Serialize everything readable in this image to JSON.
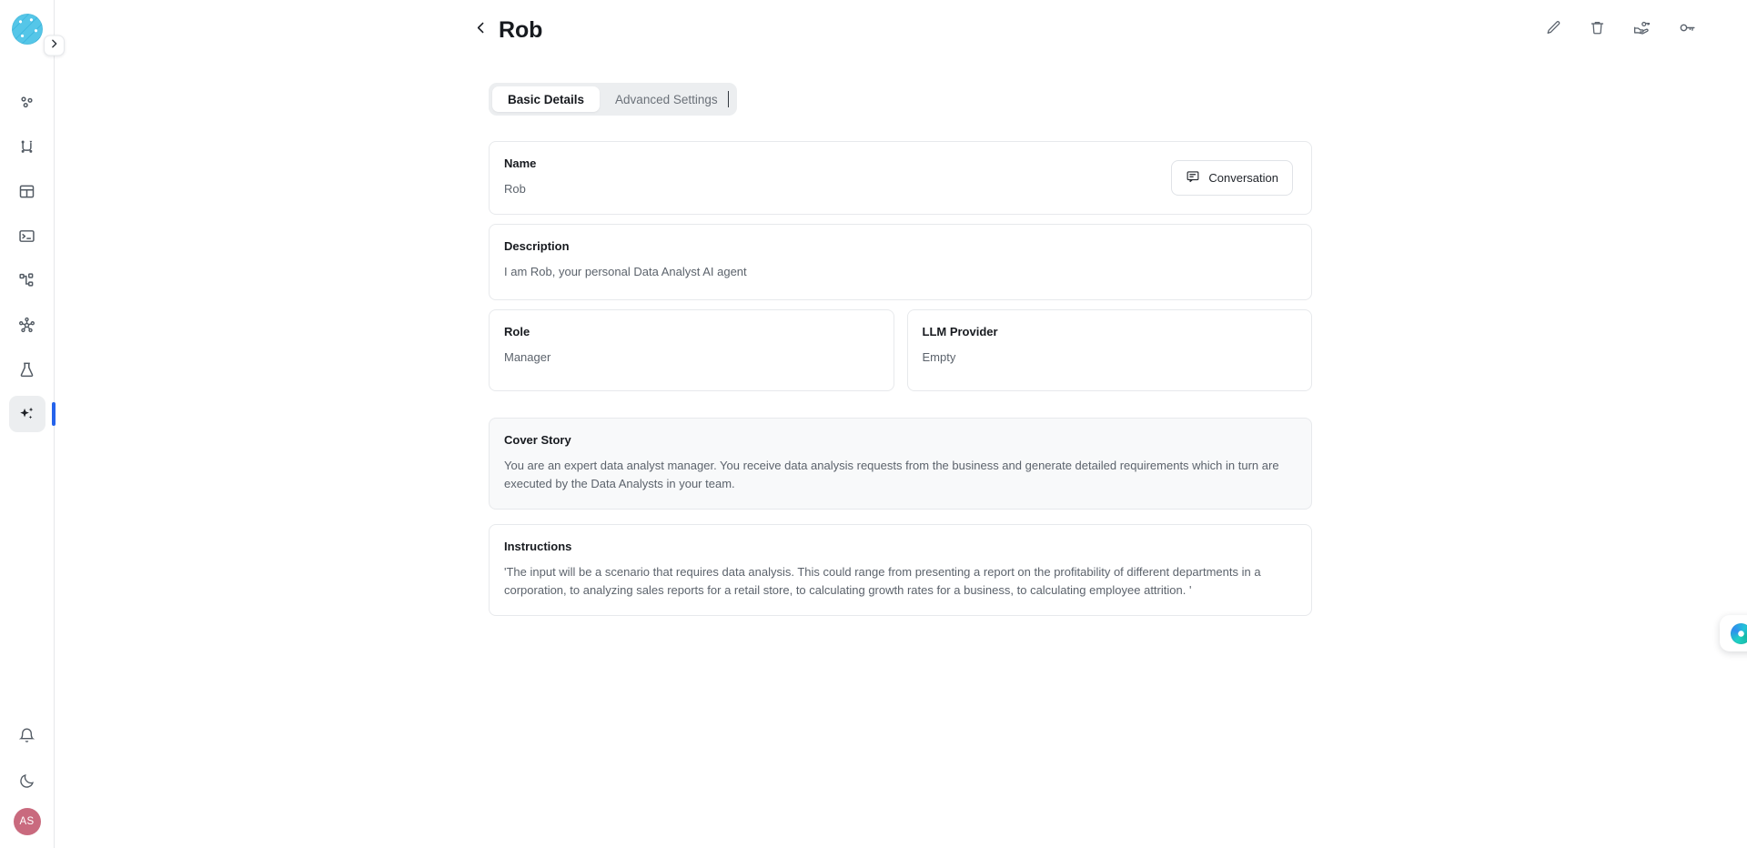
{
  "app": {
    "logo_name": "app-logo",
    "accent_color": "#2563eb",
    "avatar_color": "#c96a7e"
  },
  "sidebar": {
    "expand_button_icon": "chevron-right-icon",
    "items": [
      {
        "name": "sidebar-item-connections",
        "icon": "nodes-icon",
        "active": false
      },
      {
        "name": "sidebar-item-pipelines",
        "icon": "flow-icon",
        "active": false
      },
      {
        "name": "sidebar-item-tables",
        "icon": "table-icon",
        "active": false
      },
      {
        "name": "sidebar-item-terminal",
        "icon": "terminal-icon",
        "active": false
      },
      {
        "name": "sidebar-item-workflows",
        "icon": "hierarchy-icon",
        "active": false
      },
      {
        "name": "sidebar-item-network",
        "icon": "network-hub-icon",
        "active": false
      },
      {
        "name": "sidebar-item-experiments",
        "icon": "flask-icon",
        "active": false
      },
      {
        "name": "sidebar-item-agents",
        "icon": "sparkles-icon",
        "active": true
      }
    ],
    "bottom_items": [
      {
        "name": "notifications-button",
        "icon": "bell-icon"
      },
      {
        "name": "theme-toggle-button",
        "icon": "moon-icon"
      }
    ],
    "avatar_initials": "AS"
  },
  "header": {
    "back_icon": "chevron-left-icon",
    "title": "Rob",
    "actions": [
      {
        "name": "edit-button",
        "icon": "pencil-icon"
      },
      {
        "name": "delete-button",
        "icon": "trash-icon"
      },
      {
        "name": "share-access-button",
        "icon": "hand-key-icon"
      },
      {
        "name": "credentials-button",
        "icon": "key-icon"
      }
    ]
  },
  "tabs": {
    "basic_details": "Basic Details",
    "advanced_settings": "Advanced Settings",
    "active": "Basic Details"
  },
  "fields": {
    "name": {
      "label": "Name",
      "value": "Rob"
    },
    "description": {
      "label": "Description",
      "value": "I am Rob, your personal Data Analyst AI agent"
    },
    "role": {
      "label": "Role",
      "value": "Manager"
    },
    "llm_provider": {
      "label": "LLM Provider",
      "value": "Empty"
    },
    "cover_story": {
      "label": "Cover Story",
      "value": "You are an expert data analyst manager. You receive data analysis requests from the business and generate detailed requirements which in turn are executed by the Data Analysts in your team."
    },
    "instructions": {
      "label": "Instructions",
      "value": "'The input will be a scenario that requires data analysis. This could range from presenting a report on the profitability of different departments in a corporation, to analyzing sales reports for a retail store, to calculating growth rates for a business, to calculating employee attrition. '"
    }
  },
  "buttons": {
    "conversation": {
      "label": "Conversation",
      "icon": "chat-bubble-icon"
    }
  },
  "widget": {
    "name": "assistant-orb",
    "icon": "gradient-orb-icon"
  }
}
